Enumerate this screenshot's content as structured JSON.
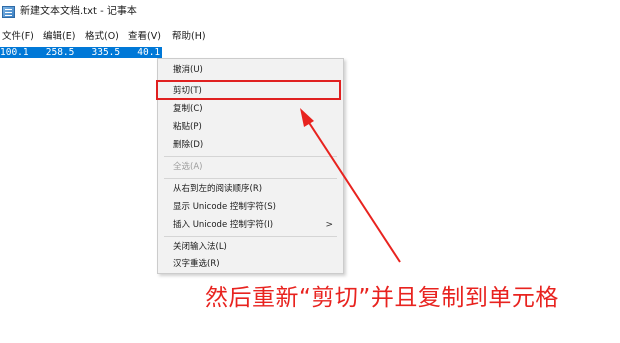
{
  "window": {
    "title": "新建文本文档.txt - 记事本"
  },
  "menubar": [
    "文件(F)",
    "编辑(E)",
    "格式(O)",
    "查看(V)",
    "帮助(H)"
  ],
  "editor": {
    "line": "100.1   258.5   335.5   40.1"
  },
  "context_menu": {
    "items": [
      {
        "label": "撤消(U)",
        "enabled": true
      },
      {
        "label": "剪切(T)",
        "enabled": true,
        "highlighted": true
      },
      {
        "label": "复制(C)",
        "enabled": true
      },
      {
        "label": "粘贴(P)",
        "enabled": true
      },
      {
        "label": "删除(D)",
        "enabled": true
      },
      {
        "label": "全选(A)",
        "enabled": false
      },
      {
        "label": "从右到左的阅读顺序(R)",
        "enabled": true
      },
      {
        "label": "显示 Unicode 控制字符(S)",
        "enabled": true
      },
      {
        "label": "插入 Unicode 控制字符(I)",
        "enabled": true,
        "submenu": true,
        "submenu_arrow": ">"
      },
      {
        "label": "关闭输入法(L)",
        "enabled": true
      },
      {
        "label": "汉字重选(R)",
        "enabled": true
      }
    ]
  },
  "annotation": {
    "text": "然后重新“剪切”并且复制到单元格",
    "color": "#e8231f"
  },
  "colors": {
    "selection": "#0078d7",
    "highlight_border": "#e02020",
    "annotation": "#e8231f"
  }
}
